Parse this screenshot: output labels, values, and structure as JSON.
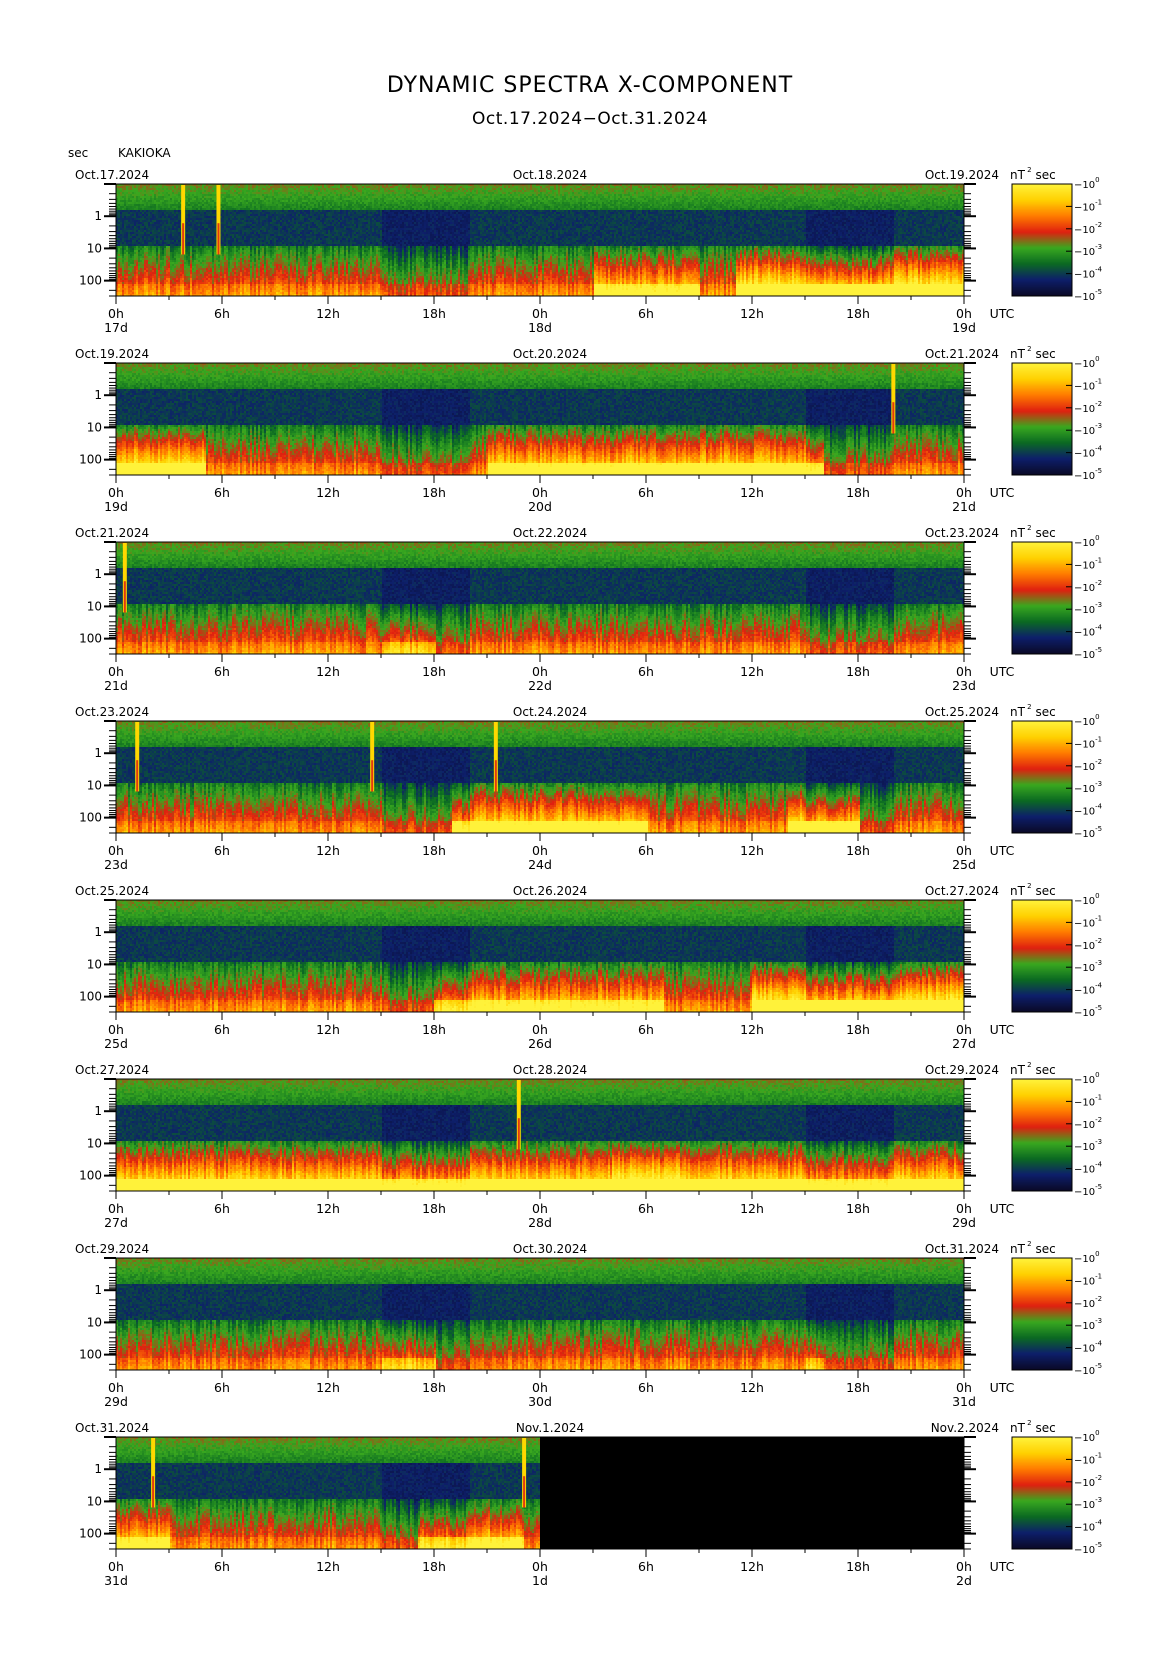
{
  "title": "DYNAMIC SPECTRA X-COMPONENT",
  "subtitle": "Oct.17.2024−Oct.31.2024",
  "y_unit": "sec",
  "station": "KAKIOKA",
  "utc_label": "UTC",
  "colorbar_unit": "nT",
  "colorbar_unit_sup": "2",
  "colorbar_unit_sec": "sec",
  "colorbar_ticks": [
    {
      "base": "10",
      "exp": "0"
    },
    {
      "base": "10",
      "exp": "-1"
    },
    {
      "base": "10",
      "exp": "-2"
    },
    {
      "base": "10",
      "exp": "-3"
    },
    {
      "base": "10",
      "exp": "-4"
    },
    {
      "base": "10",
      "exp": "-5"
    }
  ],
  "colors": {
    "colormap": [
      "#0a0a28",
      "#0d1f6b",
      "#0b6a22",
      "#39a81f",
      "#e02010",
      "#ff7a00",
      "#ffd000",
      "#fff23a"
    ],
    "no_data": "#000000"
  },
  "chart_data": {
    "type": "heatmap",
    "x_axis": {
      "range_hours": [
        0,
        48
      ],
      "hour_ticks": [
        "0h",
        "6h",
        "12h",
        "18h",
        "0h",
        "6h",
        "12h",
        "18h",
        "0h"
      ]
    },
    "y_axis": {
      "label": "sec",
      "scale": "log",
      "range": [
        0.1,
        300
      ],
      "tick_labels": [
        "1",
        "10",
        "100"
      ]
    },
    "colorbar": {
      "unit": "nT² sec",
      "scale": "log",
      "range": [
        1e-05,
        1
      ]
    },
    "panels": [
      {
        "date_left": "Oct.17.2024",
        "date_mid": "Oct.18.2024",
        "date_right": "Oct.19.2024",
        "day_labels": [
          "17d",
          "18d",
          "19d"
        ],
        "spikes": [
          3.8,
          5.8
        ],
        "data_end_hours": 48,
        "activity": [
          {
            "start": 35,
            "end": 48,
            "level": 0.9
          },
          {
            "start": 27,
            "end": 33,
            "level": 0.5
          }
        ]
      },
      {
        "date_left": "Oct.19.2024",
        "date_mid": "Oct.20.2024",
        "date_right": "Oct.21.2024",
        "day_labels": [
          "19d",
          "20d",
          "21d"
        ],
        "spikes": [
          44
        ],
        "data_end_hours": 48,
        "activity": [
          {
            "start": 0,
            "end": 5,
            "level": 0.8
          },
          {
            "start": 21,
            "end": 40,
            "level": 0.6
          }
        ]
      },
      {
        "date_left": "Oct.21.2024",
        "date_mid": "Oct.22.2024",
        "date_right": "Oct.23.2024",
        "day_labels": [
          "21d",
          "22d",
          "23d"
        ],
        "spikes": [
          0.5
        ],
        "data_end_hours": 48,
        "activity": [
          {
            "start": 15,
            "end": 18,
            "level": 0.4
          }
        ]
      },
      {
        "date_left": "Oct.23.2024",
        "date_mid": "Oct.24.2024",
        "date_right": "Oct.25.2024",
        "day_labels": [
          "23d",
          "24d",
          "25d"
        ],
        "spikes": [
          1.2,
          14.5,
          21.5
        ],
        "data_end_hours": 48,
        "activity": [
          {
            "start": 19,
            "end": 30,
            "level": 0.6
          },
          {
            "start": 38,
            "end": 42,
            "level": 0.8
          }
        ]
      },
      {
        "date_left": "Oct.25.2024",
        "date_mid": "Oct.26.2024",
        "date_right": "Oct.27.2024",
        "day_labels": [
          "25d",
          "26d",
          "27d"
        ],
        "spikes": [],
        "data_end_hours": 48,
        "activity": [
          {
            "start": 18,
            "end": 31,
            "level": 0.5
          },
          {
            "start": 36,
            "end": 48,
            "level": 0.9
          }
        ]
      },
      {
        "date_left": "Oct.27.2024",
        "date_mid": "Oct.28.2024",
        "date_right": "Oct.29.2024",
        "day_labels": [
          "27d",
          "28d",
          "29d"
        ],
        "spikes": [
          22.8
        ],
        "data_end_hours": 48,
        "activity": [
          {
            "start": 0,
            "end": 48,
            "level": 0.7
          },
          {
            "start": 28,
            "end": 32,
            "level": 1.0
          }
        ]
      },
      {
        "date_left": "Oct.29.2024",
        "date_mid": "Oct.30.2024",
        "date_right": "Oct.31.2024",
        "day_labels": [
          "29d",
          "30d",
          "31d"
        ],
        "spikes": [],
        "data_end_hours": 48,
        "activity": [
          {
            "start": 15,
            "end": 18,
            "level": 0.4
          },
          {
            "start": 39,
            "end": 40,
            "level": 0.4
          }
        ]
      },
      {
        "date_left": "Oct.31.2024",
        "date_mid": "Nov.1.2024",
        "date_right": "Nov.2.2024",
        "day_labels": [
          "31d",
          "1d",
          "2d"
        ],
        "spikes": [
          2.1,
          23.1
        ],
        "data_end_hours": 24,
        "activity": [
          {
            "start": 0,
            "end": 3,
            "level": 0.5
          },
          {
            "start": 17,
            "end": 23,
            "level": 0.5
          }
        ]
      }
    ]
  }
}
